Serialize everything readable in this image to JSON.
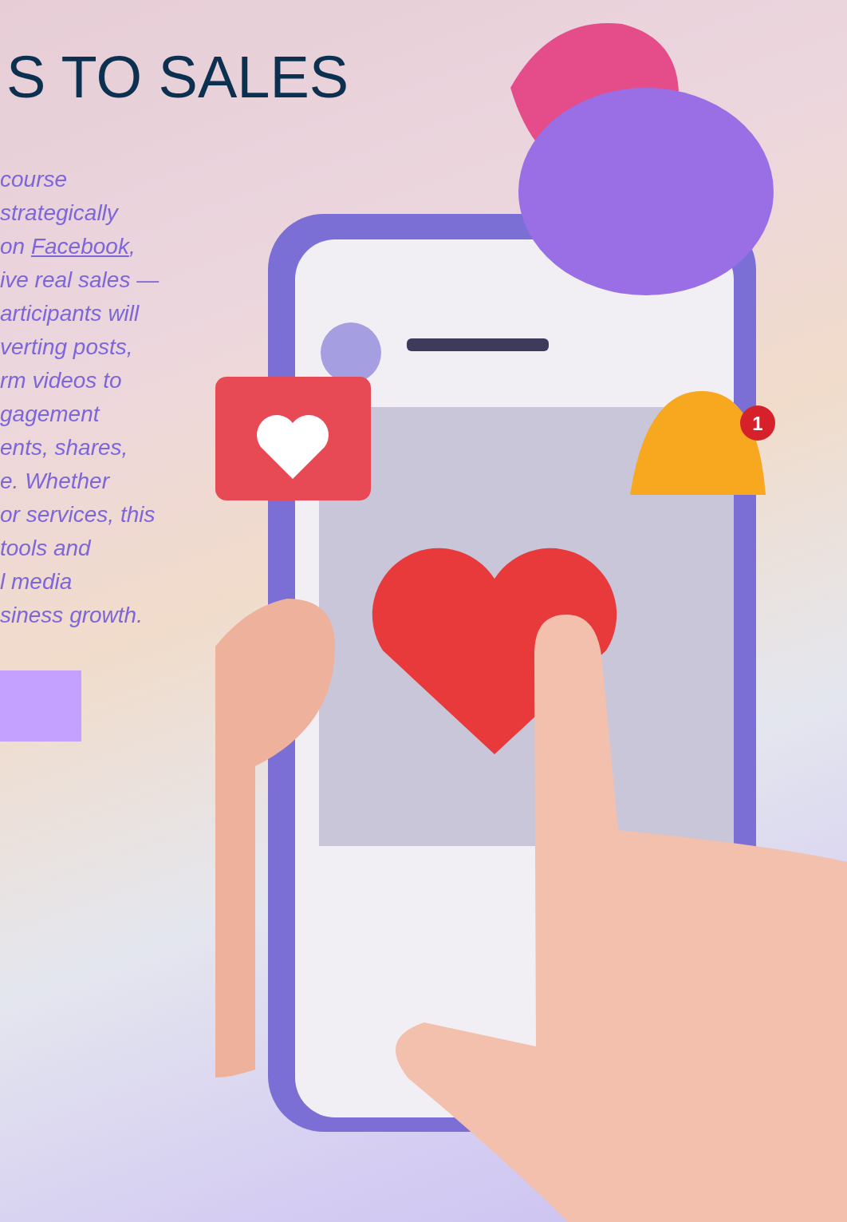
{
  "heading": "S TO SALES",
  "paragraph_lines": [
    {
      "text": "course"
    },
    {
      "text": "strategically"
    },
    {
      "text": "on",
      "link": "Facebook",
      "after": ","
    },
    {
      "text": "ive real sales —"
    },
    {
      "text": "articipants will"
    },
    {
      "text": "verting posts,"
    },
    {
      "text": "rm videos to"
    },
    {
      "text": "gagement"
    },
    {
      "text": "ents, shares,"
    },
    {
      "text": "e. Whether"
    },
    {
      "text": "or services, this"
    },
    {
      "text": "tools and"
    },
    {
      "text": "l media"
    },
    {
      "text": "siness growth."
    }
  ],
  "illustration": {
    "badge": "1"
  }
}
